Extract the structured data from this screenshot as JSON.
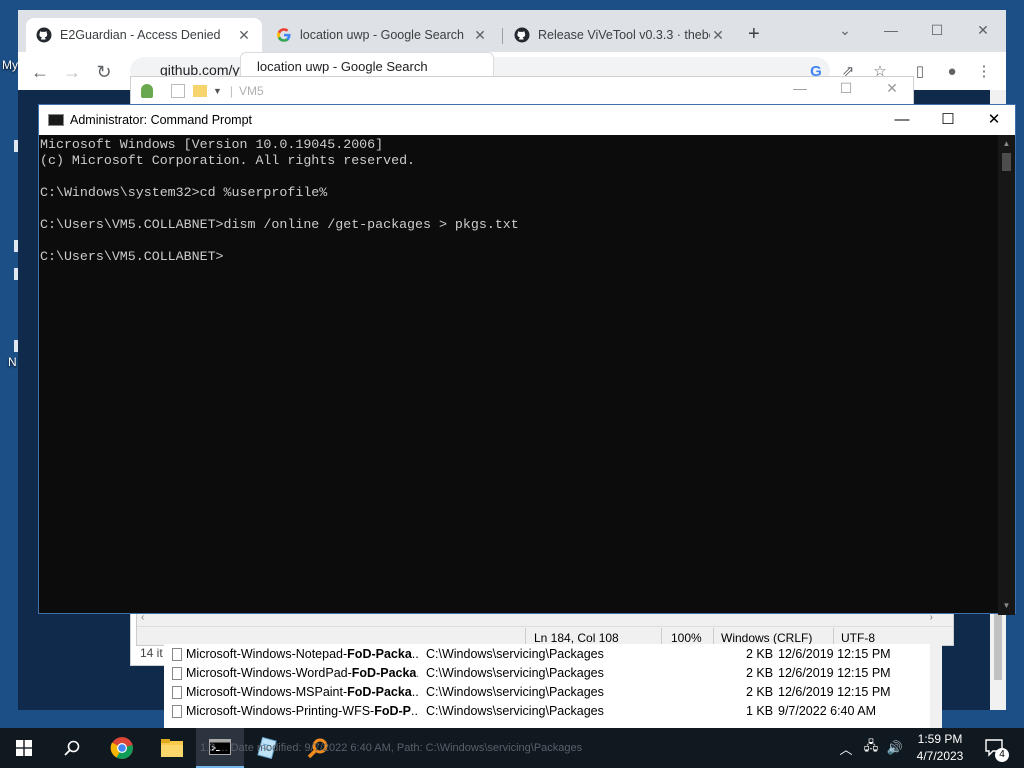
{
  "desktop": {
    "icon_label_top": "My",
    "icon_label_mid": "N"
  },
  "browser": {
    "tabs": [
      {
        "title": "E2Guardian - Access Denied",
        "icon": "github-icon"
      },
      {
        "title": "location uwp - Google Search",
        "icon": "google-icon"
      },
      {
        "title": "Release ViVeTool v0.3.3 · thebo",
        "icon": "github-icon"
      }
    ],
    "new_tab": "+",
    "address": "github.com/yyir",
    "tooltip": "location uwp - Google Search"
  },
  "explorer_window": {
    "title": "VM5",
    "status_stub": "14 it",
    "files": [
      {
        "name_prefix": "Microsoft-Windows-Notepad-",
        "name_bold": "FoD-Packa",
        "name_suffix": "...",
        "folder": "C:\\Windows\\servicing\\Packages",
        "size": "2 KB",
        "date": "12/6/2019 12:15 PM"
      },
      {
        "name_prefix": "Microsoft-Windows-WordPad-",
        "name_bold": "FoD-Packa",
        "name_suffix": "...",
        "folder": "C:\\Windows\\servicing\\Packages",
        "size": "2 KB",
        "date": "12/6/2019 12:15 PM"
      },
      {
        "name_prefix": "Microsoft-Windows-MSPaint-",
        "name_bold": "FoD-Packa",
        "name_suffix": "...",
        "folder": "C:\\Windows\\servicing\\Packages",
        "size": "2 KB",
        "date": "12/6/2019 12:15 PM"
      },
      {
        "name_prefix": "Microsoft-Windows-Printing-WFS-",
        "name_bold": "FoD-P",
        "name_suffix": "...",
        "folder": "C:\\Windows\\servicing\\Packages",
        "size": "1 KB",
        "date": "9/7/2022 6:40 AM"
      }
    ]
  },
  "notepad_status": {
    "position": "Ln 184, Col 108",
    "zoom": "100%",
    "line_endings": "Windows (CRLF)",
    "encoding": "UTF-8"
  },
  "cmd": {
    "title": "Administrator: Command Prompt",
    "lines": [
      "Microsoft Windows [Version 10.0.19045.2006]",
      "(c) Microsoft Corporation. All rights reserved.",
      "",
      "C:\\Windows\\system32>cd %userprofile%",
      "",
      "C:\\Users\\VM5.COLLABNET>dism /online /get-packages > pkgs.txt",
      "",
      "C:\\Users\\VM5.COLLABNET>"
    ]
  },
  "taskbar": {
    "preview_text": "1.3 ... Date modified: 9/7/2022 6:40 AM, Path: C:\\Windows\\servicing\\Packages",
    "time": "1:59 PM",
    "date": "4/7/2023",
    "notification_count": "4"
  }
}
